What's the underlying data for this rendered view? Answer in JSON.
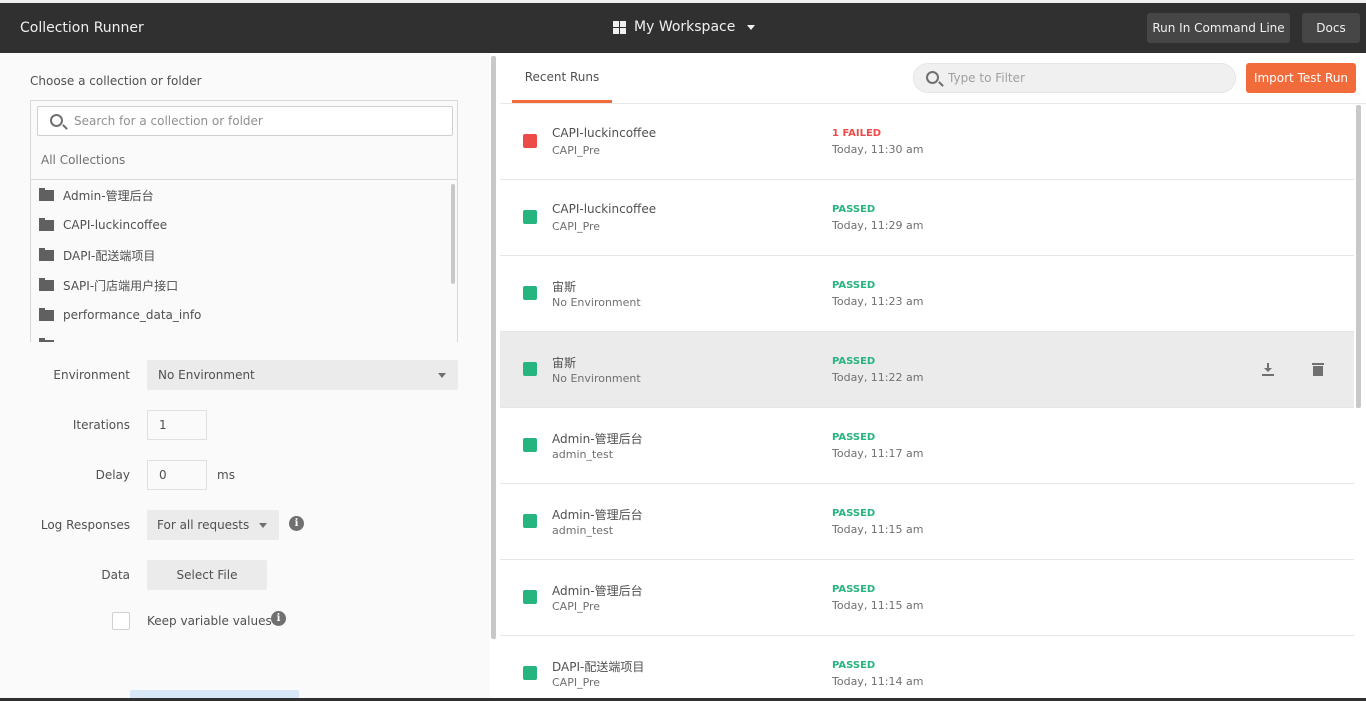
{
  "header": {
    "app_title": "Collection Runner",
    "workspace_label": "My Workspace",
    "run_cli_label": "Run In Command Line",
    "docs_label": "Docs"
  },
  "left": {
    "choose_label": "Choose a collection or folder",
    "search_placeholder": "Search for a collection or folder",
    "all_collections": "All Collections",
    "collections": [
      {
        "name": "Admin-管理后台"
      },
      {
        "name": "CAPI-luckincoffee"
      },
      {
        "name": "DAPI-配送端项目"
      },
      {
        "name": "SAPI-门店端用户接口"
      },
      {
        "name": "performance_data_info"
      }
    ],
    "environment_label": "Environment",
    "environment_value": "No Environment",
    "iterations_label": "Iterations",
    "iterations_value": "1",
    "delay_label": "Delay",
    "delay_value": "0",
    "delay_unit": "ms",
    "log_label": "Log Responses",
    "log_value": "For all requests",
    "data_label": "Data",
    "select_file_label": "Select File",
    "keep_label": "Keep variable values",
    "info_glyph": "i"
  },
  "right": {
    "tab_label": "Recent Runs",
    "filter_placeholder": "Type to Filter",
    "import_label": "Import Test Run",
    "colors": {
      "passed": "#26b47f",
      "failed": "#ed4b48",
      "accent": "#f26b3a"
    },
    "runs": [
      {
        "name": "CAPI-luckincoffee",
        "env": "CAPI_Pre",
        "status": "1 FAILED",
        "state": "failed",
        "time": "Today, 11:30 am"
      },
      {
        "name": "CAPI-luckincoffee",
        "env": "CAPI_Pre",
        "status": "PASSED",
        "state": "passed",
        "time": "Today, 11:29 am"
      },
      {
        "name": "宙斯",
        "env": "No Environment",
        "status": "PASSED",
        "state": "passed",
        "time": "Today, 11:23 am"
      },
      {
        "name": "宙斯",
        "env": "No Environment",
        "status": "PASSED",
        "state": "passed",
        "time": "Today, 11:22 am"
      },
      {
        "name": "Admin-管理后台",
        "env": "admin_test",
        "status": "PASSED",
        "state": "passed",
        "time": "Today, 11:17 am"
      },
      {
        "name": "Admin-管理后台",
        "env": "admin_test",
        "status": "PASSED",
        "state": "passed",
        "time": "Today, 11:15 am"
      },
      {
        "name": "Admin-管理后台",
        "env": "CAPI_Pre",
        "status": "PASSED",
        "state": "passed",
        "time": "Today, 11:15 am"
      },
      {
        "name": "DAPI-配送端项目",
        "env": "CAPI_Pre",
        "status": "PASSED",
        "state": "passed",
        "time": "Today, 11:14 am"
      }
    ]
  }
}
